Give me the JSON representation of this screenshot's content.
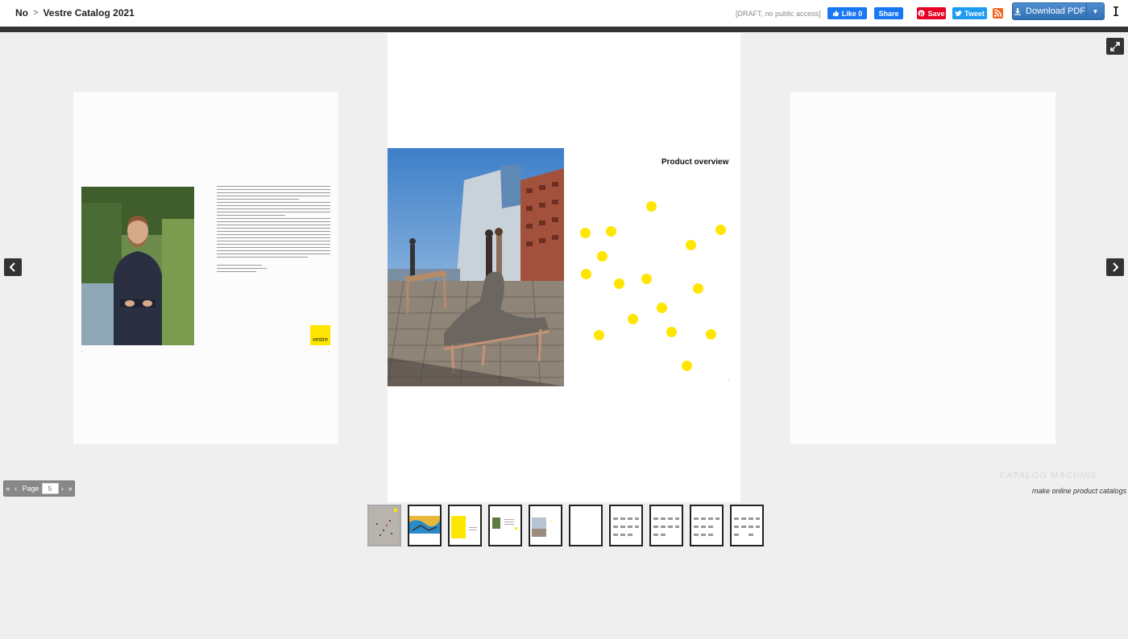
{
  "breadcrumb": {
    "root": "No",
    "separator": ">",
    "current": "Vestre Catalog 2021"
  },
  "header": {
    "draft_notice": "[DRAFT, no public access]",
    "fb_like_label": "Like 0",
    "fb_share_label": "Share",
    "pin_save_label": "Save",
    "tweet_label": "Tweet",
    "download_label": "Download PDF"
  },
  "pages": {
    "left_logo_text": "vestre",
    "spread_title": "Product overview"
  },
  "pager": {
    "label": "Page",
    "current": "5"
  },
  "branding": {
    "logo": "CATALOG MACHINE",
    "tagline": "make online product catalogs"
  },
  "thumbnails": {
    "count": 10,
    "active_index": 0
  },
  "colors": {
    "accent_yellow": "#ffe600",
    "facebook": "#1877f2",
    "pinterest": "#e60023",
    "twitter": "#1d9bf0",
    "rss": "#f26522",
    "download": "#2f6fb3"
  },
  "icons": {
    "rss": "rss-icon",
    "download": "download-icon",
    "fullscreen": "fullscreen-icon",
    "prev": "chevron-left-icon",
    "next": "chevron-right-icon"
  }
}
